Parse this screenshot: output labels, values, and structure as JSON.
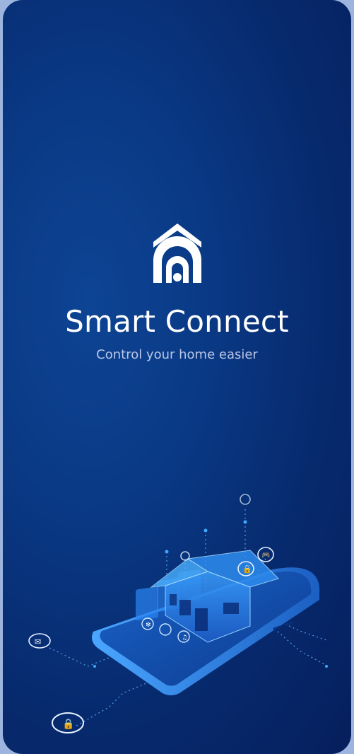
{
  "splash": {
    "app_title": "Smart Connect",
    "tagline": "Control your home easier",
    "logo_icon": "home-signal-icon"
  },
  "illustration": {
    "name": "smart-home-phone-illustration",
    "device_icons": [
      "lock-icon",
      "gamepad-icon",
      "fan-icon",
      "music-icon",
      "lightbulb-icon",
      "mail-icon",
      "lock-circle-icon"
    ]
  },
  "colors": {
    "background_top": "#0a3a86",
    "background_bottom": "#061f5c",
    "accent": "#3fa9ff",
    "title": "#ffffff",
    "subtitle": "#b9c7e6"
  }
}
